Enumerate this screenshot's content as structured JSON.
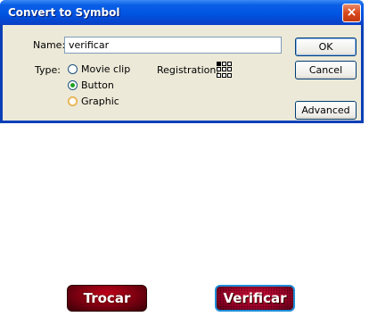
{
  "dialog": {
    "title": "Convert to Symbol",
    "close_glyph": "×",
    "name_label": "Name:",
    "name_value": "verificar",
    "type_label": "Type:",
    "types": [
      {
        "label": "Movie clip",
        "checked": false
      },
      {
        "label": "Button",
        "checked": true
      },
      {
        "label": "Graphic",
        "checked": false
      }
    ],
    "registration_label": "Registration:",
    "ok_label": "OK",
    "cancel_label": "Cancel",
    "advanced_label": "Advanced"
  },
  "stage": {
    "trocar_label": "Trocar",
    "verificar_label": "Verificar"
  },
  "colors": {
    "titlebar": "#0054e3",
    "dialog_body": "#ece9d8",
    "trocar_bg": "#7a0010",
    "verificar_bg": "#a0002a",
    "verificar_border": "#1f8fd8"
  },
  "icons": {
    "close": "close-icon",
    "registration": "registration-grid-icon"
  }
}
